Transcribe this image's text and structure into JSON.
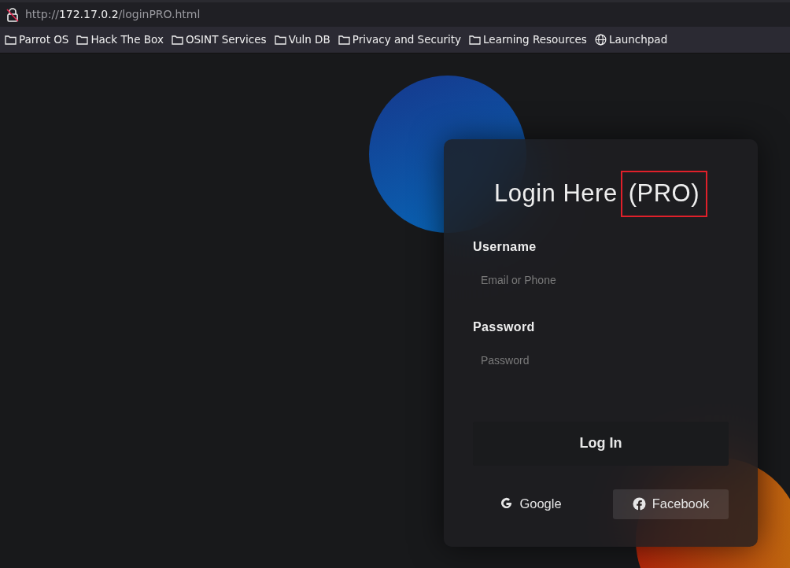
{
  "browser": {
    "address_bar": {
      "scheme": "http://",
      "host": "172.17.0.2",
      "path": "/loginPRO.html",
      "secure": false
    },
    "bookmarks": [
      {
        "label": "Parrot OS",
        "kind": "folder"
      },
      {
        "label": "Hack The Box",
        "kind": "folder"
      },
      {
        "label": "OSINT Services",
        "kind": "folder"
      },
      {
        "label": "Vuln DB",
        "kind": "folder"
      },
      {
        "label": "Privacy and Security",
        "kind": "folder"
      },
      {
        "label": "Learning Resources",
        "kind": "folder"
      },
      {
        "label": "Launchpad",
        "kind": "globe"
      }
    ]
  },
  "login": {
    "title": "Login Here",
    "title_highlight": "(PRO)",
    "fields": [
      {
        "label": "Username",
        "placeholder": "Email or Phone"
      },
      {
        "label": "Password",
        "placeholder": "Password"
      }
    ],
    "submit": "Log In",
    "social": [
      {
        "label": "Google",
        "kind": "google",
        "selected": false
      },
      {
        "label": "Facebook",
        "kind": "facebook",
        "selected": true
      }
    ]
  }
}
